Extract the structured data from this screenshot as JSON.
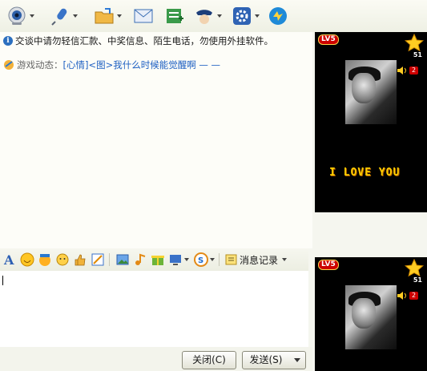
{
  "toolbar": {
    "items": [
      {
        "name": "webcam-icon",
        "has_menu": true
      },
      {
        "name": "microphone-icon",
        "has_menu": true
      },
      {
        "name": "send-file-icon",
        "has_menu": true
      },
      {
        "name": "email-icon",
        "has_menu": false
      },
      {
        "name": "add-note-icon",
        "has_menu": false
      },
      {
        "name": "police-icon",
        "has_menu": true
      },
      {
        "name": "settings-icon",
        "has_menu": true
      },
      {
        "name": "app-icon",
        "has_menu": false
      }
    ]
  },
  "chat": {
    "notice": "交谈中请勿轻信汇款、中奖信息、陌生电话，勿使用外挂软件。",
    "game_label": "游戏动态：",
    "game_link": "[心情]<图>我什么时候能觉醒啊 — —"
  },
  "format_toolbar": {
    "history_label": "消息记录"
  },
  "input": {
    "value": ""
  },
  "buttons": {
    "close_label": "关闭(C)",
    "send_label": "发送(S)"
  },
  "show": {
    "level": "LV5",
    "star_count": "51",
    "speaker_count": "2",
    "banner": "I LOVE YOU"
  },
  "colors": {
    "link": "#1d5fc2",
    "accent": "#2c6fbf"
  }
}
